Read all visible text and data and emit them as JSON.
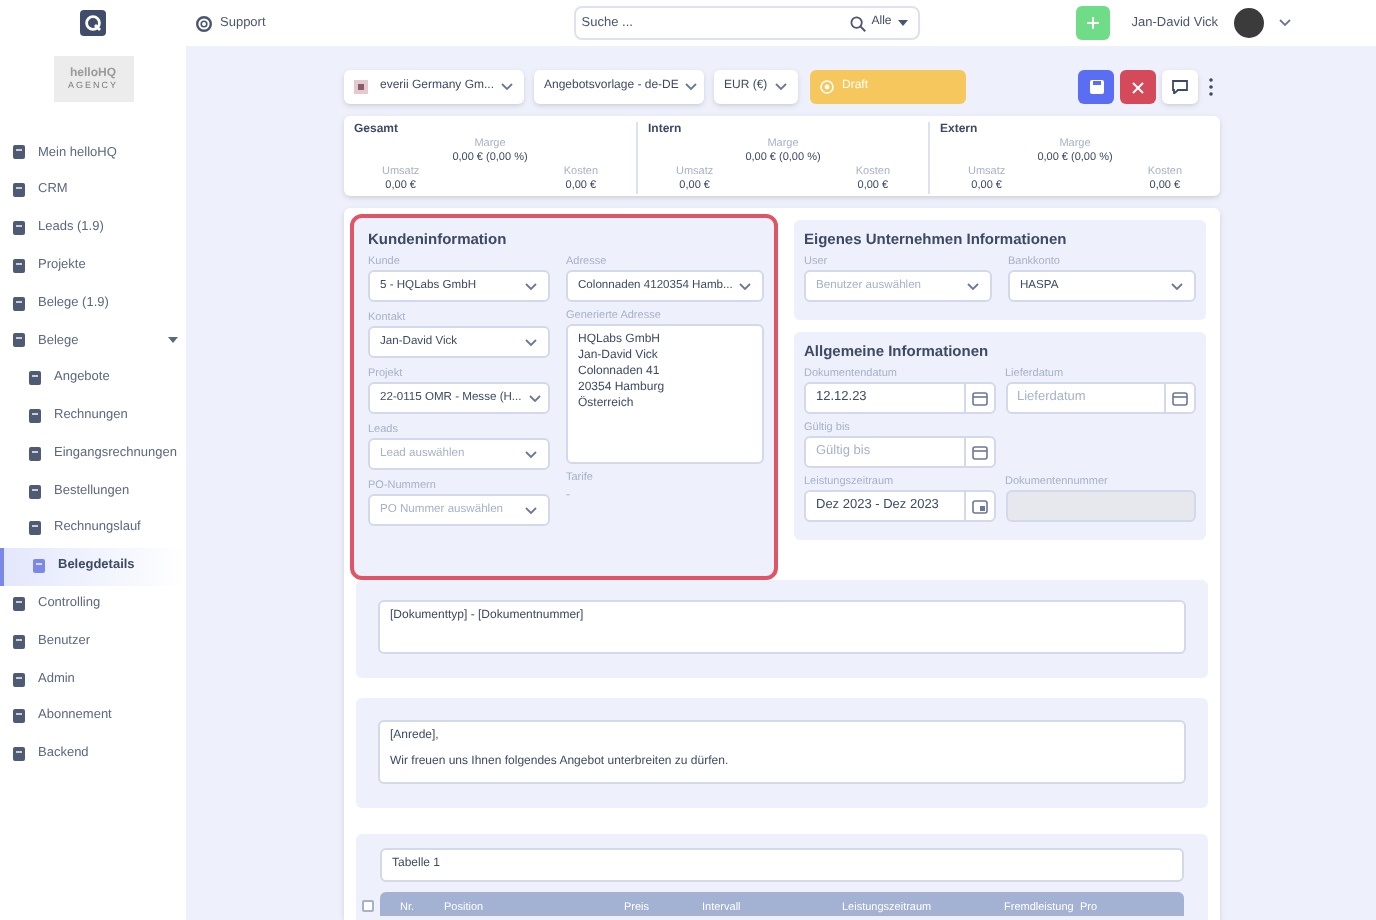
{
  "brand": {
    "name": "helloHQ",
    "tagline": "AGENCY"
  },
  "topbar": {
    "support": "Support",
    "search": {
      "placeholder": "Suche ...",
      "scope": "Alle"
    },
    "user": "Jan-David Vick"
  },
  "sidebar": {
    "items": [
      {
        "label": "Mein helloHQ",
        "selected": false
      },
      {
        "label": "CRM",
        "selected": false
      },
      {
        "label": "Leads (1.9)",
        "selected": false
      },
      {
        "label": "Projekte",
        "selected": false
      },
      {
        "label": "Belege (1.9)",
        "selected": false
      },
      {
        "label": "Belege",
        "selected": false,
        "expanded": true,
        "children": [
          {
            "label": "Angebote",
            "selected": false
          },
          {
            "label": "Rechnungen",
            "selected": false
          },
          {
            "label": "Eingangsrechnungen",
            "selected": false
          },
          {
            "label": "Bestellungen",
            "selected": false
          },
          {
            "label": "Rechnungslauf",
            "selected": false
          },
          {
            "label": "Belegdetails",
            "selected": true
          }
        ]
      },
      {
        "label": "Controlling",
        "selected": false
      },
      {
        "label": "Benutzer",
        "selected": false
      },
      {
        "label": "Admin",
        "selected": false
      },
      {
        "label": "Abonnement",
        "selected": false
      },
      {
        "label": "Backend",
        "selected": false
      }
    ]
  },
  "toolbar": {
    "company": "everii Germany Gm...",
    "template": "Angebotsvorlage - de-DE",
    "currency": "EUR (€)",
    "status": "Draft"
  },
  "summary": [
    {
      "title": "Gesamt",
      "marge_label": "Marge",
      "marge": "0,00 € (0,00 %)",
      "umsatz_label": "Umsatz",
      "umsatz": "0,00 €",
      "kosten_label": "Kosten",
      "kosten": "0,00 €"
    },
    {
      "title": "Intern",
      "marge_label": "Marge",
      "marge": "0,00 € (0,00 %)",
      "umsatz_label": "Umsatz",
      "umsatz": "0,00 €",
      "kosten_label": "Kosten",
      "kosten": "0,00 €"
    },
    {
      "title": "Extern",
      "marge_label": "Marge",
      "marge": "0,00 € (0,00 %)",
      "umsatz_label": "Umsatz",
      "umsatz": "0,00 €",
      "kosten_label": "Kosten",
      "kosten": "0,00 €"
    }
  ],
  "customer": {
    "title": "Kundeninformation",
    "fields": [
      {
        "label": "Kunde",
        "value": "5 - HQLabs GmbH"
      },
      {
        "label": "Kontakt",
        "value": "Jan-David Vick"
      },
      {
        "label": "Projekt",
        "value": "22-0115 OMR - Messe (H..."
      },
      {
        "label": "Leads",
        "placeholder": "Lead auswählen"
      },
      {
        "label": "PO-Nummern",
        "placeholder": "PO Nummer auswählen"
      }
    ],
    "address": {
      "label": "Adresse",
      "value": "Colonnaden 4120354 Hamb..."
    },
    "generated_address": {
      "label": "Generierte Adresse",
      "lines": [
        "HQLabs GmbH",
        "Jan-David Vick",
        "Colonnaden 41",
        "20354 Hamburg",
        "Österreich"
      ]
    },
    "tariff": {
      "label": "Tarife",
      "value": "-"
    }
  },
  "own_company": {
    "title": "Eigenes Unternehmen Informationen",
    "fields": [
      {
        "label": "User",
        "placeholder": "Benutzer auswählen"
      },
      {
        "label": "Bankkonto",
        "value": "HASPA"
      }
    ]
  },
  "general": {
    "title": "Allgemeine Informationen",
    "rows": [
      [
        {
          "label": "Dokumentendatum",
          "value": "12.12.23",
          "kind": "date",
          "disabled": false
        },
        {
          "label": "Lieferdatum",
          "placeholder": "Lieferdatum",
          "kind": "date",
          "disabled": false
        }
      ],
      [
        {
          "label": "Gültig bis",
          "placeholder": "Gültig bis",
          "kind": "date",
          "disabled": false
        }
      ],
      [
        {
          "label": "Leistungszeitraum",
          "value": "Dez 2023 - Dez 2023",
          "kind": "range",
          "disabled": false
        },
        {
          "label": "Dokumentennummer",
          "kind": "text",
          "disabled": true
        }
      ]
    ]
  },
  "document_title": "[Dokumenttyp] - [Dokumentnummer]",
  "intro": [
    "[Anrede],",
    "Wir freuen uns Ihnen folgendes Angebot unterbreiten zu dürfen."
  ],
  "table": {
    "name": "Tabelle 1",
    "select_all": {
      "checked": false
    },
    "columns": [
      "Nr.",
      "Position",
      "Preis",
      "Intervall",
      "Leistungszeitraum",
      "Fremdleistung",
      "Pro"
    ]
  }
}
